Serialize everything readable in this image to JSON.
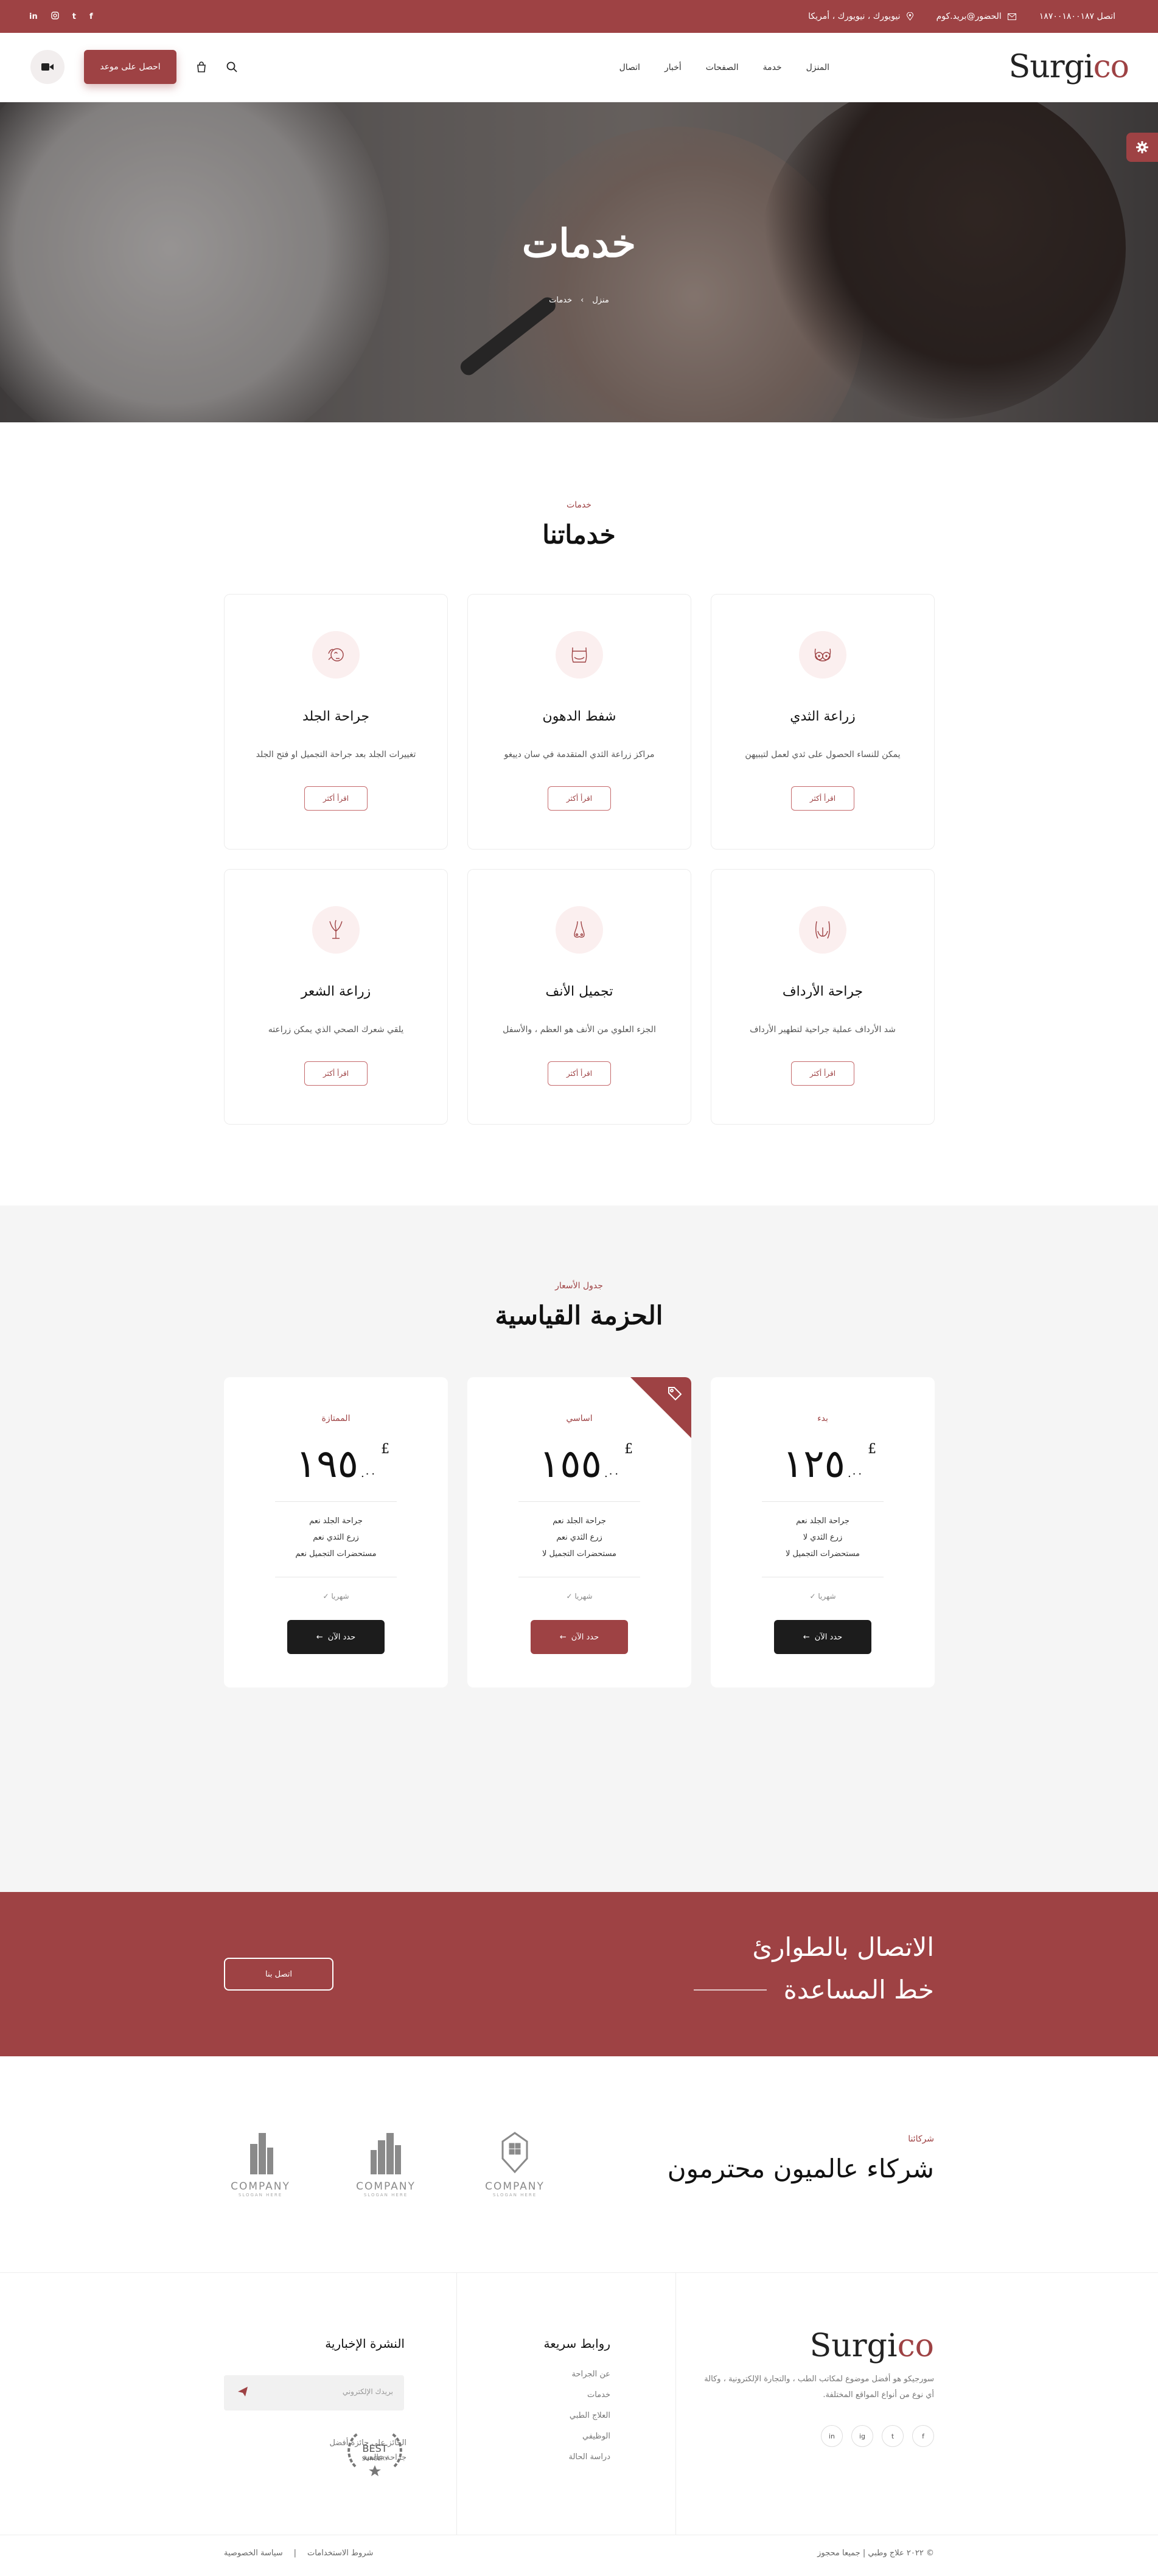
{
  "topbar": {
    "phone": "اتصل ١٨٧٠٠١٨٠٠١٨٧",
    "email": "الحضور@بريد.كوم",
    "address": "نيويورك ، نيويورك ، أمريكا",
    "social": [
      "f",
      "t",
      "i",
      "in"
    ]
  },
  "header": {
    "logo_main": "Surgi",
    "logo_accent": "co",
    "nav": [
      "المنزل",
      "خدمة",
      "الصفحات",
      "أخبار",
      "اتصال"
    ],
    "book_label": "احصل على موعد"
  },
  "hero": {
    "title": "خدمات",
    "crumb_home": "منزل",
    "crumb_current": "خدمات"
  },
  "services": {
    "eyebrow": "خدمات",
    "title": "خدماتنا",
    "more_label": "اقرأ أكثر",
    "items": [
      {
        "title": "زراعة الثدي",
        "text": "يمكن للنساء الحصول على ثدي لعمل لتيبيهن",
        "icon": "breast-icon"
      },
      {
        "title": "شفط الدهون",
        "text": "مراكز زراعة الثدي المتقدمة في سان دييغو",
        "icon": "liposuction-icon"
      },
      {
        "title": "جراحة الجلد",
        "text": "تغييرات الجلد بعد جراحة التجميل او فتح الجلد",
        "icon": "skin-icon"
      },
      {
        "title": "جراحة الأرداف",
        "text": "شد الأرداف عملية جراحية لتطهير الأرداف",
        "icon": "buttocks-icon"
      },
      {
        "title": "تجميل الأنف",
        "text": "الجزء العلوي من الأنف هو العظم ، والأسفل",
        "icon": "nose-icon"
      },
      {
        "title": "زراعة الشعر",
        "text": "يلقي شعرك الصحي الذي يمكن زراعته",
        "icon": "hair-icon"
      }
    ]
  },
  "pricing": {
    "eyebrow": "جدول الأسعار",
    "title": "الحزمة القياسية",
    "currency": "£",
    "plans": [
      {
        "name": "بدء",
        "price": "١٢٥",
        "cents": ".٠٠",
        "features": [
          "جراحة الجلد نعم",
          "زرع الثدي لا",
          "مستحضرات التجميل لا"
        ],
        "period": "شهريا",
        "button": "حدد الآن",
        "highlight": false
      },
      {
        "name": "اساسي",
        "price": "١٥٥",
        "cents": ".٠٠",
        "features": [
          "جراحة الجلد نعم",
          "زرع الثدي نعم",
          "مستحضرات التجميل لا"
        ],
        "period": "شهريا",
        "button": "حدد الآن",
        "highlight": true
      },
      {
        "name": "الممتازة",
        "price": "١٩٥",
        "cents": ".٠٠",
        "features": [
          "جراحة الجلد نعم",
          "زرع الثدي نعم",
          "مستحضرات التجميل نعم"
        ],
        "period": "شهريا",
        "button": "حدد الآن",
        "highlight": false
      }
    ]
  },
  "emergency": {
    "line1": "الاتصال بالطوارئ",
    "line2": "خط المساعدة",
    "button": "اتصل بنا"
  },
  "partners": {
    "eyebrow": "شركائنا",
    "title": "شركاء عالميون محترمون",
    "logos": [
      {
        "name": "COMPANY",
        "slogan": "SLOGAN HERE"
      },
      {
        "name": "COMPANY",
        "slogan": "SLOGAN HERE"
      },
      {
        "name": "COMPANY",
        "slogan": "SLOGAN HERE"
      }
    ]
  },
  "footer": {
    "logo_main": "Surgi",
    "logo_accent": "co",
    "description": "سورجيكو هو أفضل موضوع لمكاتب الطب ، والتجارة الإلكترونية ، وكالة أي نوع من أنواع المواقع المختلفة.",
    "social": [
      "f",
      "t",
      "ig",
      "in"
    ],
    "quick_title": "روابط سريعة",
    "quick_links": [
      "عن الجراحة",
      "خدمات",
      "العلاج الطبي",
      "الوظيفي",
      "دراسة الحالة"
    ],
    "news_title": "النشرة الإخبارية",
    "news_placeholder": "بريدك الإلكتروني",
    "award_text": "الحائز على جائزة أفضل جراحة عالمية",
    "badge_line1": "BEST",
    "badge_line2": "SURGERY"
  },
  "copyright": {
    "text": "© ٢٠٢٢ علاج وطبي | جميعا محجوز",
    "privacy": "سياسة الخصوصية",
    "sep": "|",
    "terms": "شروط الاستخدامات"
  },
  "colors": {
    "brand": "#9e4244",
    "dark": "#1c1c1c"
  }
}
